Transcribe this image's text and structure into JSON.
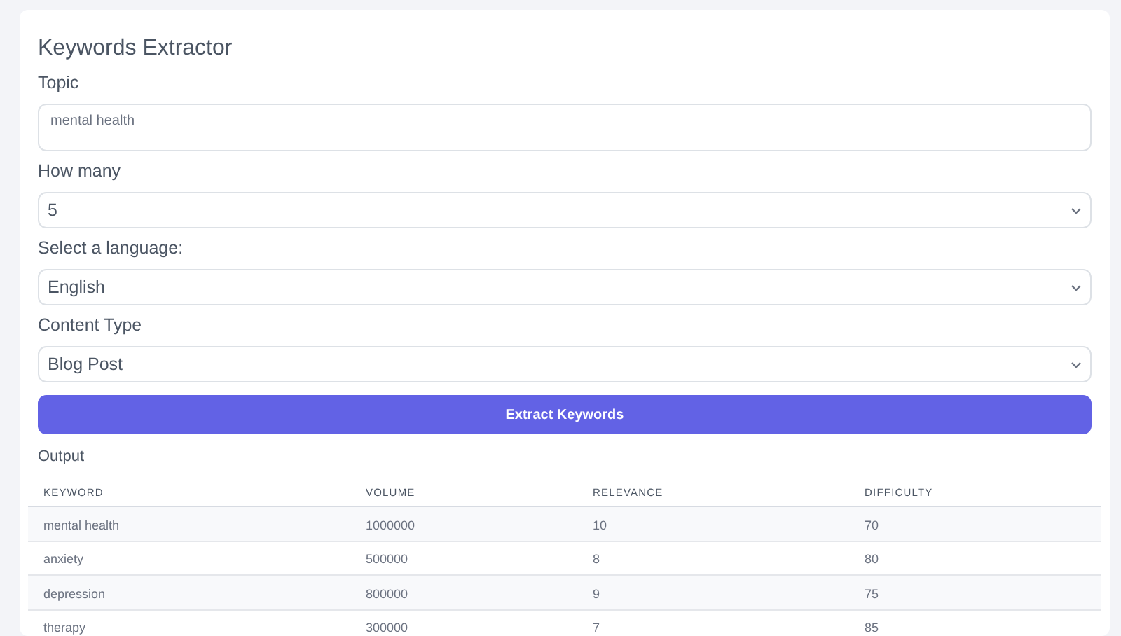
{
  "title": "Keywords Extractor",
  "fields": [
    {
      "kind": "textarea",
      "label": "Topic",
      "value": "mental health"
    },
    {
      "kind": "select",
      "label": "How many",
      "value": "5"
    },
    {
      "kind": "select",
      "label": "Select a language:",
      "value": "English"
    },
    {
      "kind": "select",
      "label": "Content Type",
      "value": "Blog Post"
    }
  ],
  "button": "Extract Keywords",
  "output_label": "Output",
  "table": {
    "columns": [
      "KEYWORD",
      "VOLUME",
      "RELEVANCE",
      "DIFFICULTY"
    ],
    "rows": [
      [
        "mental health",
        "1000000",
        "10",
        "70"
      ],
      [
        "anxiety",
        "500000",
        "8",
        "80"
      ],
      [
        "depression",
        "800000",
        "9",
        "75"
      ],
      [
        "therapy",
        "300000",
        "7",
        "85"
      ]
    ]
  }
}
